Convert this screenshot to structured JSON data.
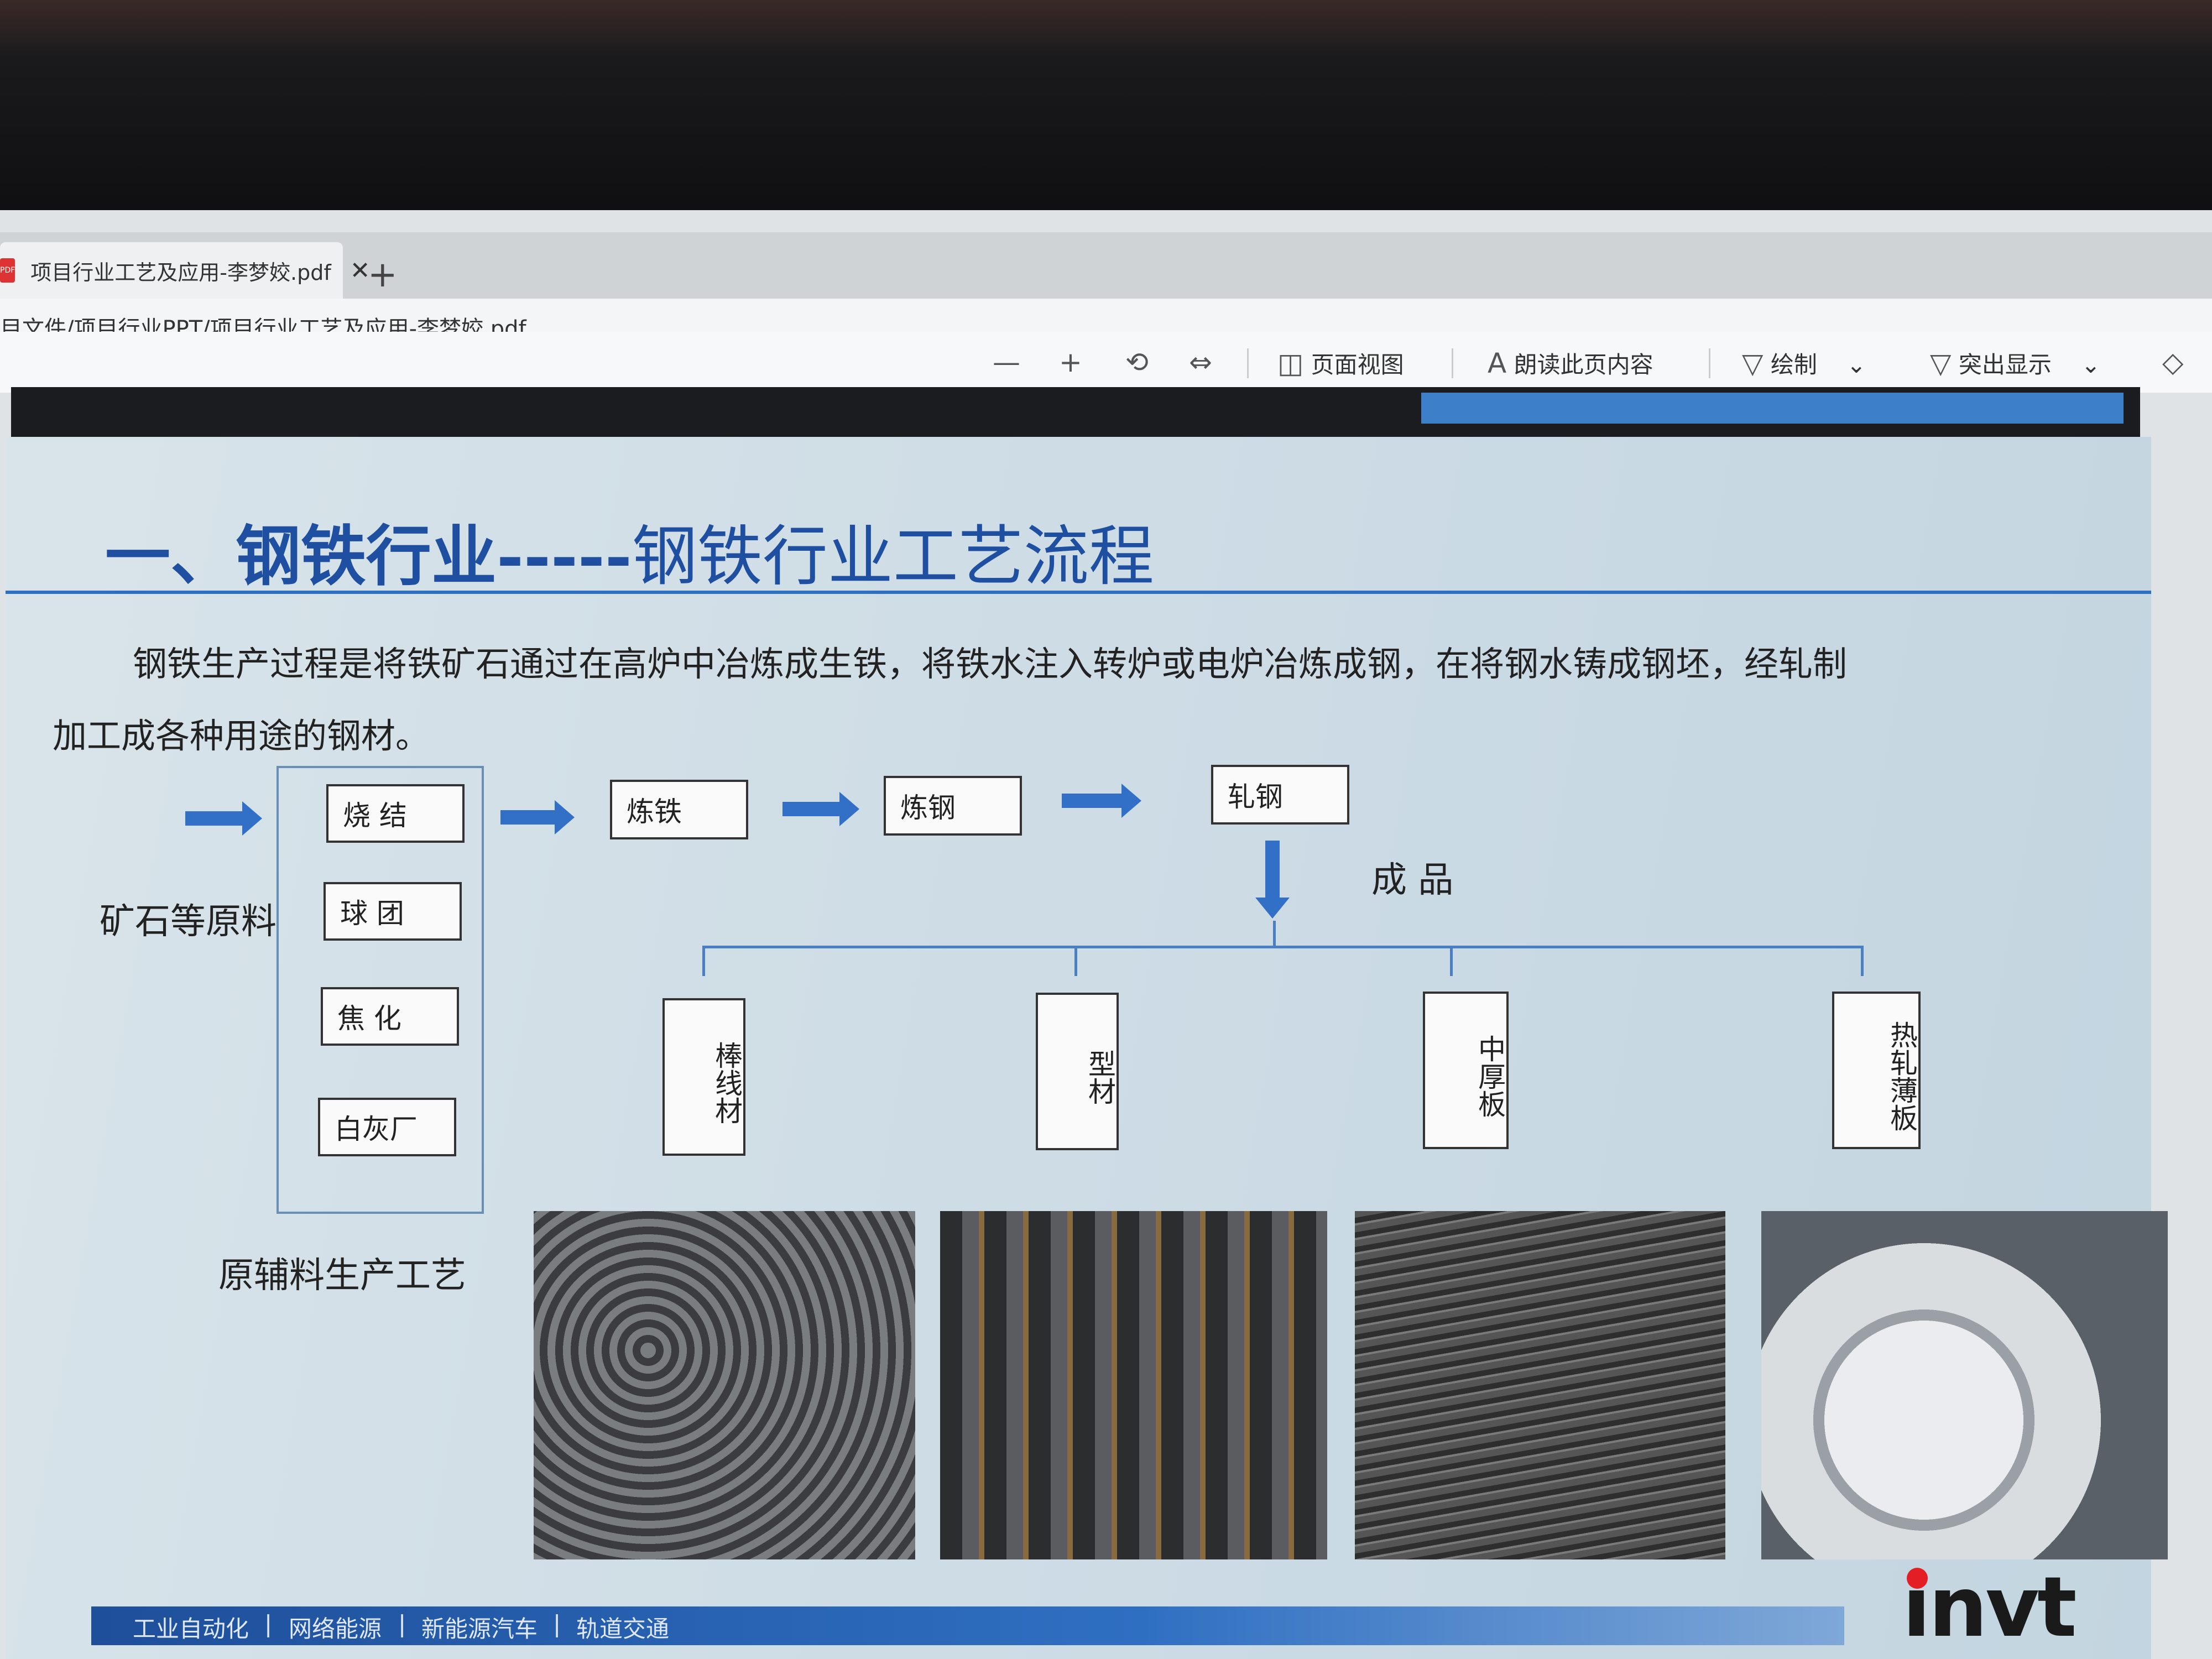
{
  "browser": {
    "tab_title": "项目行业工艺及应用-李梦姣.pdf",
    "tab_close": "✕",
    "new_tab": "+",
    "pdf_badge": "PDF",
    "address": "目文件/项目行业PPT/项目行业工艺及应用-李梦姣.pdf"
  },
  "toolbar": {
    "zoom_out": "—",
    "zoom_in": "+",
    "rotate": "⟲",
    "fit": "⇔",
    "page_view_icon": "◫",
    "page_view": "页面视图",
    "read_aloud_icon": "A",
    "read_aloud": "朗读此页内容",
    "draw_icon": "▽",
    "draw": "绘制",
    "chevron": "⌄",
    "highlight_icon": "▽",
    "highlight": "突出显示",
    "erase_icon": "◇"
  },
  "slide": {
    "title_bold": "一、钢铁行业-----",
    "title_rest": "钢铁行业工艺流程",
    "para_line1": "钢铁生产过程是将铁矿石通过在高炉中冶炼成生铁，将铁水注入转炉或电炉冶炼成钢，在将钢水铸成钢坯，经轧制",
    "para_line2": "加工成各种用途的钢材。",
    "raw_material": "矿石等原料",
    "aux_process": "原辅料生产工艺",
    "aux_items": [
      "烧 结",
      "球 团",
      "焦 化",
      "白灰厂"
    ],
    "steps": [
      "炼铁",
      "炼钢",
      "轧钢"
    ],
    "product_label": "成  品",
    "products": [
      "棒线材",
      "型材",
      "中厚板",
      "热轧薄板"
    ],
    "footer_items": [
      "工业自动化",
      "|",
      "网络能源",
      "|",
      "新能源汽车",
      "|",
      "轨道交通"
    ],
    "logo": "invt"
  }
}
